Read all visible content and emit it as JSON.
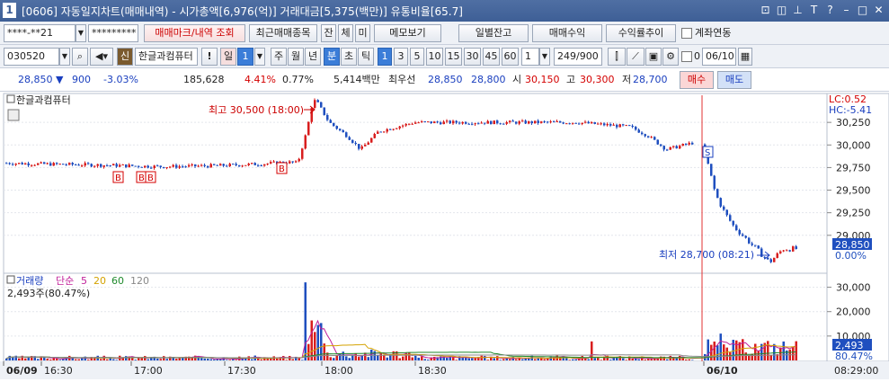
{
  "window": {
    "number": "1",
    "title": "[0606] 자동일지차트(매매내역) - 시가총액[6,976(억)] 거래대금[5,375(백만)] 유통비율[65.7]"
  },
  "toolbar1": {
    "account": "****-**21",
    "password": "*********",
    "trade_mark_btn": "매매마크/내역 조회",
    "recent_btn": "최근매매종목",
    "jan": "잔",
    "che": "체",
    "mi": "미",
    "memo_btn": "메모보기",
    "daily_balance_btn": "일별잔고",
    "trade_profit_btn": "매매수익",
    "return_trend_btn": "수익률추이",
    "account_link": "계좌연동"
  },
  "toolbar2": {
    "code": "030520",
    "sin": "신",
    "stock_name": "한글과컴퓨터",
    "excl": "!",
    "period_il": "일",
    "period_num": "1",
    "period_ju": "주",
    "period_wol": "월",
    "period_nyeon": "년",
    "period_bun": "분",
    "period_cho": "초",
    "period_tik": "틱",
    "minute_options": [
      "1",
      "3",
      "5",
      "10",
      "15",
      "30",
      "45",
      "60"
    ],
    "minute_selected": "1",
    "custom_minute": "1",
    "count": "249/900",
    "zero": "0",
    "date": "06/10"
  },
  "quote": {
    "price": "28,850",
    "change": "900",
    "change_rate": "-3.03%",
    "volume": "185,628",
    "vol_rate": "4.41%",
    "turnover": "0.77%",
    "amount": "5,414백만",
    "priority_label": "최우선",
    "ask": "28,850",
    "bid": "28,800",
    "open_label": "시",
    "open": "30,150",
    "high_label": "고",
    "high": "30,300",
    "low_label": "저",
    "low": "28,700",
    "buy_btn": "매수",
    "sell_btn": "매도"
  },
  "chart": {
    "panel_title": "한글과컴퓨터",
    "lc": "LC:0.52",
    "hc": "HC:-5.41",
    "high_annotation": "최고 30,500 (18:00)",
    "low_annotation": "최저 28,700 (08:21)",
    "price_ticks": [
      "30,250",
      "30,000",
      "29,750",
      "29,500",
      "29,250",
      "29,000"
    ],
    "current_price_label": "28,850",
    "current_pct_label": "0.00%",
    "volume_legend": {
      "name": "거래량",
      "ma_label": "단순",
      "ma1": "5",
      "ma2": "20",
      "ma3": "60",
      "ma4": "120"
    },
    "volume_info": "2,493주(80.47%)",
    "volume_ticks": [
      "30,000",
      "20,000",
      "10,000"
    ],
    "volume_current": "2,493",
    "volume_pct": "80.47%",
    "time_labels": [
      "06/09",
      "16:30",
      "17:00",
      "17:30",
      "18:00",
      "18:30",
      "06/10"
    ],
    "time_right": "08:29:00",
    "markers": [
      "B",
      "B",
      "B",
      "B",
      "S"
    ],
    "colors": {
      "up": "#d81e1e",
      "down": "#1f4fbf",
      "ma5": "#c0209a",
      "ma20": "#d4a200",
      "ma60": "#1f8a2c",
      "ma120": "#888888"
    }
  },
  "chart_data": {
    "type": "line",
    "title": "한글과컴퓨터",
    "x_labels": [
      "06/09",
      "16:30",
      "17:00",
      "17:30",
      "18:00",
      "18:30",
      "06/10",
      "08:29"
    ],
    "price_series": {
      "name": "한글과컴퓨터",
      "points": [
        [
          "16:20",
          29800
        ],
        [
          "16:30",
          29790
        ],
        [
          "16:45",
          29780
        ],
        [
          "17:00",
          29760
        ],
        [
          "17:15",
          29770
        ],
        [
          "17:30",
          29790
        ],
        [
          "17:40",
          29810
        ],
        [
          "17:45",
          29800
        ],
        [
          "17:48",
          30150
        ],
        [
          "17:55",
          30450
        ],
        [
          "18:00",
          30500
        ],
        [
          "18:05",
          30250
        ],
        [
          "18:10",
          30100
        ],
        [
          "18:15",
          29950
        ],
        [
          "18:20",
          30150
        ],
        [
          "18:25",
          30200
        ],
        [
          "18:30",
          30250
        ],
        [
          "18:45",
          30250
        ],
        [
          "19:00",
          30250
        ],
        [
          "19:15",
          30250
        ],
        [
          "19:30",
          30200
        ],
        [
          "19:45",
          30100
        ],
        [
          "20:00",
          29950
        ],
        [
          "06/10 08:00",
          30050
        ],
        [
          "08:02",
          29800
        ],
        [
          "08:05",
          29450
        ],
        [
          "08:08",
          29250
        ],
        [
          "08:12",
          29100
        ],
        [
          "08:15",
          28950
        ],
        [
          "08:18",
          28800
        ],
        [
          "08:21",
          28700
        ],
        [
          "08:25",
          28850
        ],
        [
          "08:29",
          28850
        ]
      ],
      "ylim": [
        28600,
        30550
      ]
    },
    "volume_series": {
      "name": "거래량",
      "ylim": [
        0,
        35000
      ],
      "max_bar": 32000,
      "last": 2493
    }
  }
}
